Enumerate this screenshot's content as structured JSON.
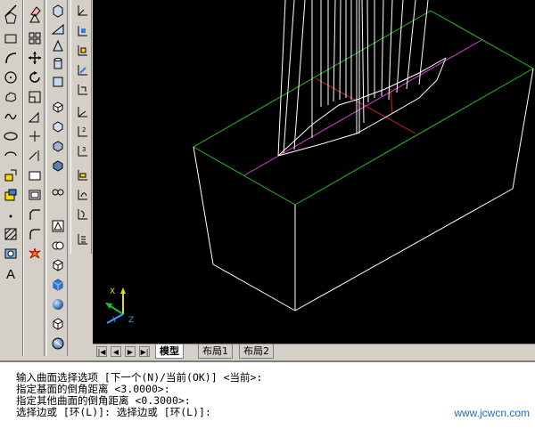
{
  "toolbars": {
    "draw": [
      "line-icon",
      "polygon-icon",
      "rectangle-icon",
      "arc-icon",
      "circle-icon",
      "revcloud-icon",
      "spline-icon",
      "ellipse-icon",
      "ellipse-arc-icon",
      "insert-block-icon",
      "make-block-icon",
      "point-icon",
      "hatch-icon",
      "region-icon",
      "multiline-text-icon"
    ],
    "modify": [
      "erase-icon",
      "copy-icon",
      "mirror-icon",
      "offset-icon",
      "array-icon",
      "move-icon",
      "rotate-icon",
      "scale-icon",
      "stretch-icon",
      "trim-icon",
      "extend-icon",
      "break-icon",
      "join-icon",
      "chamfer-icon",
      "fillet-icon",
      "explode-icon"
    ],
    "solids": [
      "box-icon",
      "wedge-icon",
      "cone-icon",
      "cylinder-icon",
      "sphere-icon",
      "torus-icon",
      "pyramid-icon",
      "extrude-icon",
      "revolve-icon",
      "slice-icon",
      "section-icon",
      "interfere-icon",
      "view-3d-icon",
      "box-3d-icon",
      "sphere-shaded-icon",
      "dome-icon",
      "wedge-shaded-icon",
      "torus-shaded-icon"
    ],
    "ucs": [
      "ucs-icon",
      "ucs-world-icon",
      "ucs-previous-icon",
      "ucs-face-icon",
      "ucs-object-icon",
      "ucs-view-icon",
      "ucs-origin-icon",
      "ucs-zaxis-icon",
      "ucs-3point-icon",
      "ucs-x-icon",
      "ucs-y-icon",
      "ucs-z-icon",
      "ucs-apply-icon",
      "ucs-named-icon"
    ]
  },
  "viewport": {
    "background": "#000000",
    "ucs_labels": {
      "x": "X",
      "y": "Y",
      "z": "Z"
    }
  },
  "tabs": {
    "model": "模型",
    "layout1": "布局1",
    "layout2": "布局2"
  },
  "command_lines": [
    "输入曲面选择选项 [下一个(N)/当前(OK)] <当前>:",
    "指定基面的倒角距离 <3.0000>:",
    "指定其他曲面的倒角距离 <0.3000>:",
    "选择边或 [环(L)]: 选择边或 [环(L)]:"
  ],
  "watermark": "www.jcwcn.com"
}
